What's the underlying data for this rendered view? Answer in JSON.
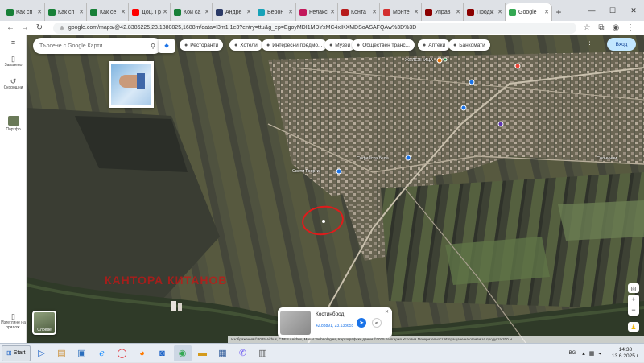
{
  "browser": {
    "tabs": [
      {
        "label": "Как сп",
        "color": "#188038"
      },
      {
        "label": "Как сп",
        "color": "#188038"
      },
      {
        "label": "Как се",
        "color": "#188038"
      },
      {
        "label": "Доц. Гр",
        "color": "#ff0000"
      },
      {
        "label": "Кои са",
        "color": "#188038"
      },
      {
        "label": "Андре",
        "color": "#2b3a67"
      },
      {
        "label": "Верон",
        "color": "#17a2b8"
      },
      {
        "label": "Релакс",
        "color": "#c2185b"
      },
      {
        "label": "Конта",
        "color": "#b71c1c"
      },
      {
        "label": "Монте",
        "color": "#d32f2f"
      },
      {
        "label": "Управ",
        "color": "#8b0000"
      },
      {
        "label": "Продж",
        "color": "#8b0000"
      },
      {
        "label": "Google",
        "color": "#34a853"
      }
    ],
    "url": "google.com/maps/@42.8386225,23.1380825,1688m/data=!3m1!1e3?entry=ttu&g_ep=EgoyMDI1MDYxMC4xIKXMDSoASAFQAw%3D%3D"
  },
  "sidebar": {
    "saved_label": "Запазено",
    "recents_label": "Скорошни",
    "recent_place_label": "Портфо",
    "app_label": "Изтегляне на прилож."
  },
  "map": {
    "search_placeholder": "Търсене с Google Карти",
    "chips": [
      "Ресторанти",
      "Хотели",
      "Интересни предмо...",
      "Музеи",
      "Обществен транс...",
      "Аптеки",
      "Банкомати"
    ],
    "chip_icons": [
      "fork-knife",
      "bed",
      "camera",
      "museum",
      "bus",
      "pharmacy",
      "atm"
    ],
    "login_label": "Вход",
    "watermark": "КАНТОРА КИТАНОВ",
    "town_labels": [
      "ЖЕЛЕЗНИЦА",
      "Свети Георги",
      "Софийска бела",
      "Солнични"
    ],
    "layers_label": "Слоеве",
    "attribution": "Изображения ©2025 Airbus, CNES / Airbus, Maxar Technologies, Картографски данни ©2025   България   Условия   Поверителност   Изпращане на отзиви за продукта   200 м"
  },
  "place": {
    "name": "Костинброд",
    "coords": "42.83891, 23.138655"
  },
  "taskbar": {
    "start_label": "Start",
    "lang": "BG",
    "time": "14:38",
    "date": "13.6.2025 г."
  }
}
